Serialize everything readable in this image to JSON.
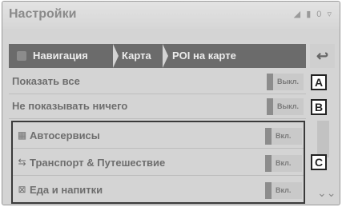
{
  "window": {
    "title": "Настройки",
    "status_indicators": "◢ ▮ 0 ▿"
  },
  "breadcrumb": {
    "items": [
      {
        "label": "Навигация"
      },
      {
        "label": "Карта"
      },
      {
        "label": "POI на карте"
      }
    ],
    "back_icon": "↩"
  },
  "settings": [
    {
      "label": "Показать все",
      "state": "Выкл.",
      "callout": "A"
    },
    {
      "label": "Не показывать ничего",
      "state": "Выкл.",
      "callout": "B"
    }
  ],
  "poi_categories": [
    {
      "icon": "car-service-icon",
      "glyph": "▦",
      "label": "Автосервисы",
      "state": "Вкл."
    },
    {
      "icon": "transport-travel-icon",
      "glyph": "⇆",
      "label": "Транспорт & Путешествие",
      "state": "Вкл."
    },
    {
      "icon": "food-drink-icon",
      "glyph": "⊠",
      "label": "Еда и напитки",
      "state": "Вкл."
    }
  ],
  "group_callout": "C",
  "scroll_down_icon": "⌄⌄"
}
